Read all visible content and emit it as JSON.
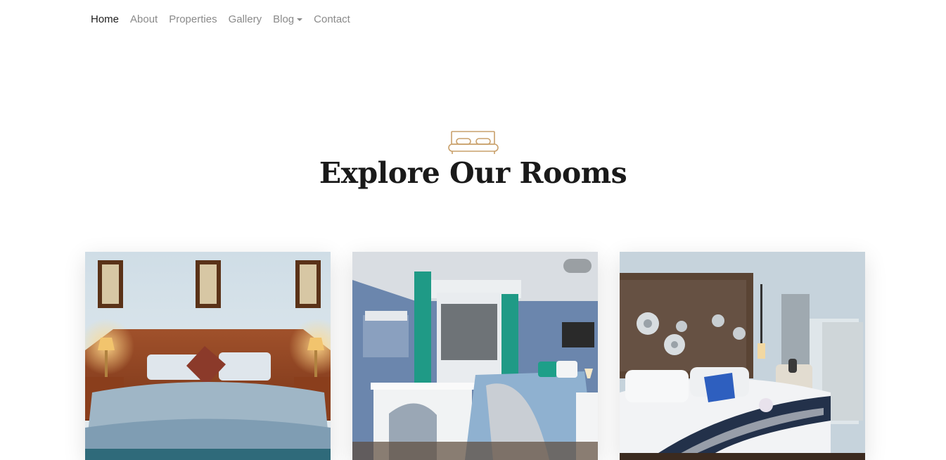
{
  "nav": {
    "items": [
      {
        "label": "Home"
      },
      {
        "label": "About"
      },
      {
        "label": "Properties"
      },
      {
        "label": "Gallery"
      },
      {
        "label": "Blog"
      },
      {
        "label": "Contact"
      }
    ]
  },
  "section": {
    "title": "Explore Our Rooms",
    "icon": "bed-icon",
    "accent_color": "#c9a06b"
  },
  "rooms": [
    {
      "image": "bedroom-wood-headboard-photo"
    },
    {
      "image": "blue-bedroom-with-desk-photo"
    },
    {
      "image": "hotel-suite-bedroom-photo"
    }
  ]
}
